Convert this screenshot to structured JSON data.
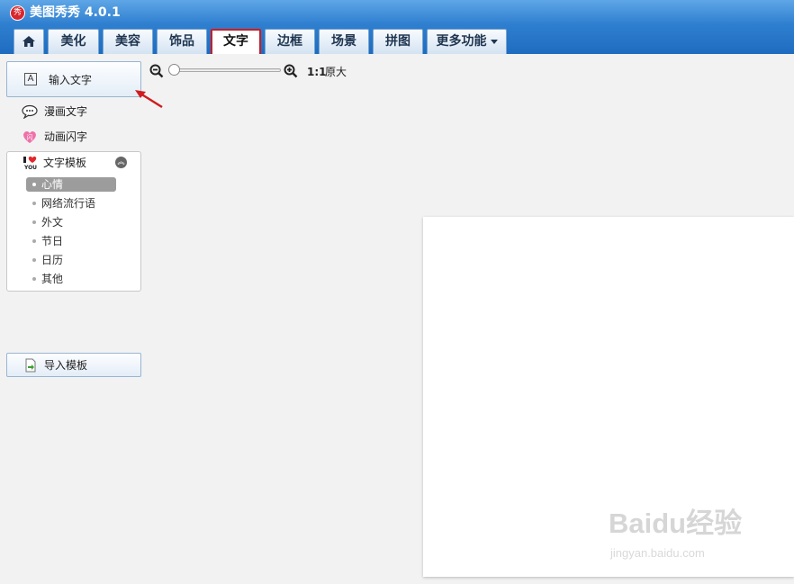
{
  "app": {
    "logo_char": "秀",
    "title": "美图秀秀 4.0.1"
  },
  "tabs": [
    {
      "label": "美化"
    },
    {
      "label": "美容"
    },
    {
      "label": "饰品"
    },
    {
      "label": "文字"
    },
    {
      "label": "边框"
    },
    {
      "label": "场景"
    },
    {
      "label": "拼图"
    },
    {
      "label": "更多功能"
    }
  ],
  "active_tab": "文字",
  "sidebar": {
    "input_text": "输入文字",
    "comic_text": "漫画文字",
    "animated_text": "动画闪字",
    "template_header": "文字模板",
    "template_categories": [
      "心情",
      "网络流行语",
      "外文",
      "节日",
      "日历",
      "其他"
    ],
    "selected_category": "心情",
    "import_template": "导入模板"
  },
  "zoom": {
    "ratio_label": "1:1",
    "original_label": "原大",
    "level_fraction": 0.0
  },
  "watermark": {
    "main": "Baidu经验",
    "sub": "jingyan.baidu.com"
  },
  "colors": {
    "titlebar": "#2f7fd0",
    "active_tab_border": "#d01b1f",
    "arrow": "#d01b1f"
  }
}
